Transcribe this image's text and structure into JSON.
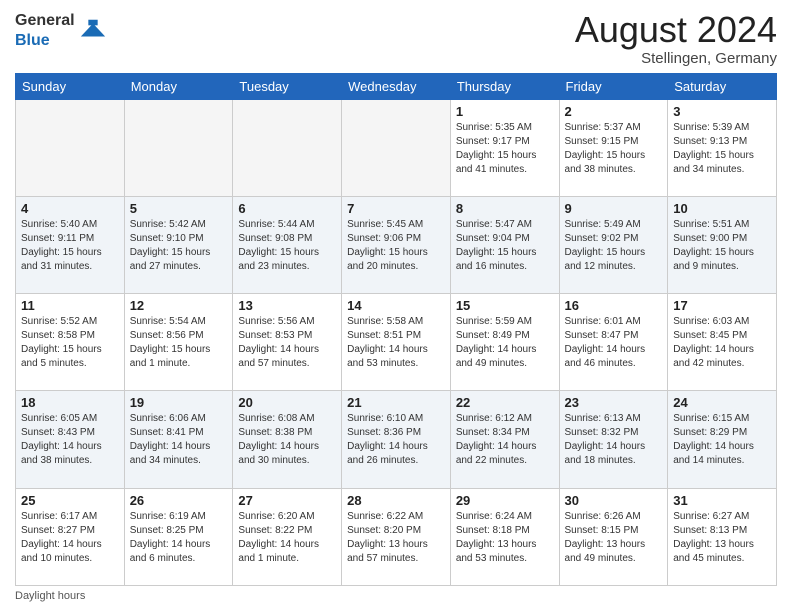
{
  "header": {
    "logo_general": "General",
    "logo_blue": "Blue",
    "month_title": "August 2024",
    "location": "Stellingen, Germany"
  },
  "weekdays": [
    "Sunday",
    "Monday",
    "Tuesday",
    "Wednesday",
    "Thursday",
    "Friday",
    "Saturday"
  ],
  "weeks": [
    [
      {
        "day": "",
        "info": ""
      },
      {
        "day": "",
        "info": ""
      },
      {
        "day": "",
        "info": ""
      },
      {
        "day": "",
        "info": ""
      },
      {
        "day": "1",
        "info": "Sunrise: 5:35 AM\nSunset: 9:17 PM\nDaylight: 15 hours\nand 41 minutes."
      },
      {
        "day": "2",
        "info": "Sunrise: 5:37 AM\nSunset: 9:15 PM\nDaylight: 15 hours\nand 38 minutes."
      },
      {
        "day": "3",
        "info": "Sunrise: 5:39 AM\nSunset: 9:13 PM\nDaylight: 15 hours\nand 34 minutes."
      }
    ],
    [
      {
        "day": "4",
        "info": "Sunrise: 5:40 AM\nSunset: 9:11 PM\nDaylight: 15 hours\nand 31 minutes."
      },
      {
        "day": "5",
        "info": "Sunrise: 5:42 AM\nSunset: 9:10 PM\nDaylight: 15 hours\nand 27 minutes."
      },
      {
        "day": "6",
        "info": "Sunrise: 5:44 AM\nSunset: 9:08 PM\nDaylight: 15 hours\nand 23 minutes."
      },
      {
        "day": "7",
        "info": "Sunrise: 5:45 AM\nSunset: 9:06 PM\nDaylight: 15 hours\nand 20 minutes."
      },
      {
        "day": "8",
        "info": "Sunrise: 5:47 AM\nSunset: 9:04 PM\nDaylight: 15 hours\nand 16 minutes."
      },
      {
        "day": "9",
        "info": "Sunrise: 5:49 AM\nSunset: 9:02 PM\nDaylight: 15 hours\nand 12 minutes."
      },
      {
        "day": "10",
        "info": "Sunrise: 5:51 AM\nSunset: 9:00 PM\nDaylight: 15 hours\nand 9 minutes."
      }
    ],
    [
      {
        "day": "11",
        "info": "Sunrise: 5:52 AM\nSunset: 8:58 PM\nDaylight: 15 hours\nand 5 minutes."
      },
      {
        "day": "12",
        "info": "Sunrise: 5:54 AM\nSunset: 8:56 PM\nDaylight: 15 hours\nand 1 minute."
      },
      {
        "day": "13",
        "info": "Sunrise: 5:56 AM\nSunset: 8:53 PM\nDaylight: 14 hours\nand 57 minutes."
      },
      {
        "day": "14",
        "info": "Sunrise: 5:58 AM\nSunset: 8:51 PM\nDaylight: 14 hours\nand 53 minutes."
      },
      {
        "day": "15",
        "info": "Sunrise: 5:59 AM\nSunset: 8:49 PM\nDaylight: 14 hours\nand 49 minutes."
      },
      {
        "day": "16",
        "info": "Sunrise: 6:01 AM\nSunset: 8:47 PM\nDaylight: 14 hours\nand 46 minutes."
      },
      {
        "day": "17",
        "info": "Sunrise: 6:03 AM\nSunset: 8:45 PM\nDaylight: 14 hours\nand 42 minutes."
      }
    ],
    [
      {
        "day": "18",
        "info": "Sunrise: 6:05 AM\nSunset: 8:43 PM\nDaylight: 14 hours\nand 38 minutes."
      },
      {
        "day": "19",
        "info": "Sunrise: 6:06 AM\nSunset: 8:41 PM\nDaylight: 14 hours\nand 34 minutes."
      },
      {
        "day": "20",
        "info": "Sunrise: 6:08 AM\nSunset: 8:38 PM\nDaylight: 14 hours\nand 30 minutes."
      },
      {
        "day": "21",
        "info": "Sunrise: 6:10 AM\nSunset: 8:36 PM\nDaylight: 14 hours\nand 26 minutes."
      },
      {
        "day": "22",
        "info": "Sunrise: 6:12 AM\nSunset: 8:34 PM\nDaylight: 14 hours\nand 22 minutes."
      },
      {
        "day": "23",
        "info": "Sunrise: 6:13 AM\nSunset: 8:32 PM\nDaylight: 14 hours\nand 18 minutes."
      },
      {
        "day": "24",
        "info": "Sunrise: 6:15 AM\nSunset: 8:29 PM\nDaylight: 14 hours\nand 14 minutes."
      }
    ],
    [
      {
        "day": "25",
        "info": "Sunrise: 6:17 AM\nSunset: 8:27 PM\nDaylight: 14 hours\nand 10 minutes."
      },
      {
        "day": "26",
        "info": "Sunrise: 6:19 AM\nSunset: 8:25 PM\nDaylight: 14 hours\nand 6 minutes."
      },
      {
        "day": "27",
        "info": "Sunrise: 6:20 AM\nSunset: 8:22 PM\nDaylight: 14 hours\nand 1 minute."
      },
      {
        "day": "28",
        "info": "Sunrise: 6:22 AM\nSunset: 8:20 PM\nDaylight: 13 hours\nand 57 minutes."
      },
      {
        "day": "29",
        "info": "Sunrise: 6:24 AM\nSunset: 8:18 PM\nDaylight: 13 hours\nand 53 minutes."
      },
      {
        "day": "30",
        "info": "Sunrise: 6:26 AM\nSunset: 8:15 PM\nDaylight: 13 hours\nand 49 minutes."
      },
      {
        "day": "31",
        "info": "Sunrise: 6:27 AM\nSunset: 8:13 PM\nDaylight: 13 hours\nand 45 minutes."
      }
    ]
  ],
  "footer": {
    "note": "Daylight hours"
  }
}
